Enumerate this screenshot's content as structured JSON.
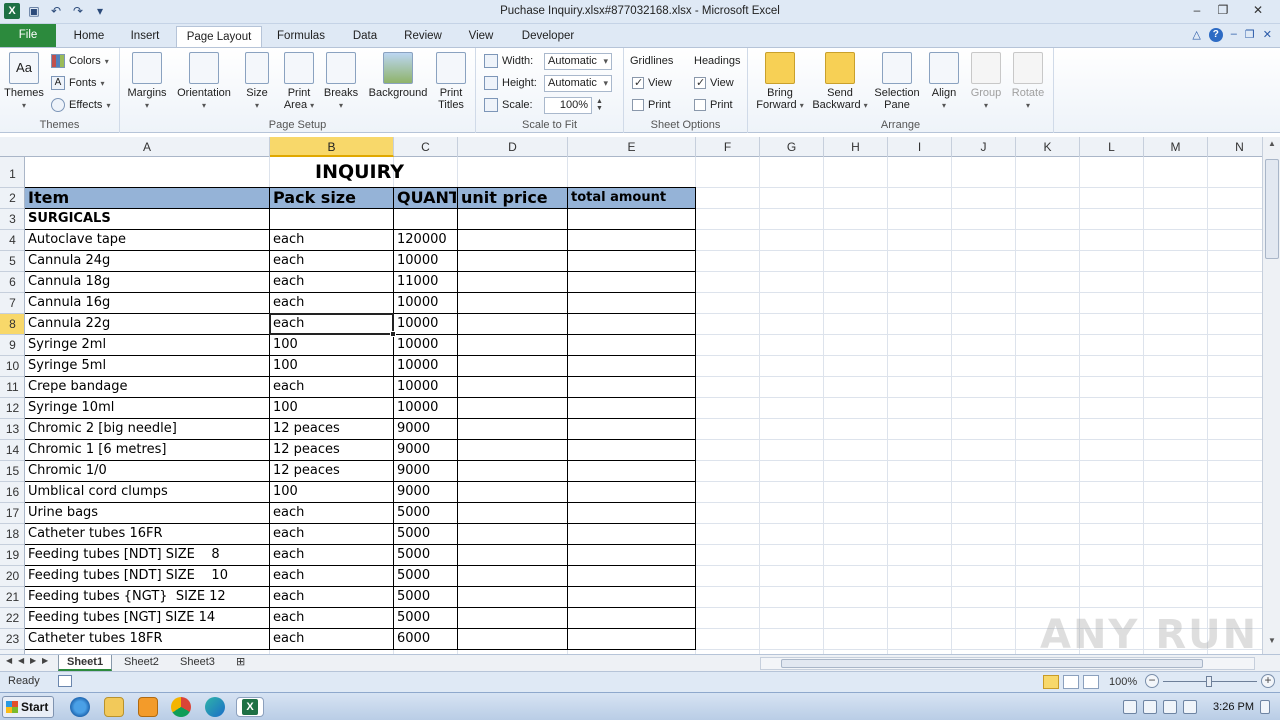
{
  "titlebar": {
    "title": "Puchase Inquiry.xlsx#877032168.xlsx  -  Microsoft Excel"
  },
  "tabs": {
    "file": "File",
    "home": "Home",
    "insert": "Insert",
    "page_layout": "Page Layout",
    "formulas": "Formulas",
    "data": "Data",
    "review": "Review",
    "view": "View",
    "developer": "Developer"
  },
  "ribbon": {
    "themes": {
      "themes": "Themes",
      "colors": "Colors",
      "fonts": "Fonts",
      "effects": "Effects",
      "group": "Themes"
    },
    "page_setup": {
      "margins": "Margins",
      "orientation": "Orientation",
      "size": "Size",
      "print_area_1": "Print",
      "print_area_2": "Area",
      "breaks": "Breaks",
      "background": "Background",
      "print_titles_1": "Print",
      "print_titles_2": "Titles",
      "group": "Page Setup"
    },
    "scale": {
      "width_label": "Width:",
      "width_value": "Automatic",
      "height_label": "Height:",
      "height_value": "Automatic",
      "scale_label": "Scale:",
      "scale_value": "100%",
      "group": "Scale to Fit"
    },
    "sheet_options": {
      "gridlines": "Gridlines",
      "headings": "Headings",
      "view1": "View",
      "print1": "Print",
      "view2": "View",
      "print2": "Print",
      "group": "Sheet Options"
    },
    "arrange": {
      "bring_forward_1": "Bring",
      "bring_forward_2": "Forward",
      "send_backward_1": "Send",
      "send_backward_2": "Backward",
      "selection_pane_1": "Selection",
      "selection_pane_2": "Pane",
      "align": "Align",
      "group_btn": "Group",
      "rotate": "Rotate",
      "group": "Arrange"
    }
  },
  "columns": [
    "A",
    "B",
    "C",
    "D",
    "E",
    "F",
    "G",
    "H",
    "I",
    "J",
    "K",
    "L",
    "M",
    "N"
  ],
  "rows": [
    "1",
    "2",
    "3",
    "4",
    "5",
    "6",
    "7",
    "8",
    "9",
    "10",
    "11",
    "12",
    "13",
    "14",
    "15",
    "16",
    "17",
    "18",
    "19",
    "20",
    "21",
    "22",
    "23"
  ],
  "sheet": {
    "title": "INQUIRY",
    "headers": {
      "item": "Item",
      "pack": "Pack size",
      "qty": "QUANT",
      "unit_price": "unit price",
      "total": "total amount"
    },
    "section": "SURGICALS",
    "items": [
      {
        "item": "Autoclave tape",
        "pack": "each",
        "qty": "120000"
      },
      {
        "item": "Cannula 24g",
        "pack": "each",
        "qty": "10000"
      },
      {
        "item": "Cannula 18g",
        "pack": "each",
        "qty": "11000"
      },
      {
        "item": "Cannula 16g",
        "pack": "each",
        "qty": "10000"
      },
      {
        "item": "Cannula 22g",
        "pack": "each",
        "qty": "10000"
      },
      {
        "item": "Syringe 2ml",
        "pack": "100",
        "qty": "10000"
      },
      {
        "item": "Syringe 5ml",
        "pack": "100",
        "qty": "10000"
      },
      {
        "item": "Crepe bandage",
        "pack": "each",
        "qty": "10000"
      },
      {
        "item": "Syringe 10ml",
        "pack": "100",
        "qty": "10000"
      },
      {
        "item": "Chromic 2 [big needle]",
        "pack": "12 peaces",
        "qty": "9000"
      },
      {
        "item": "Chromic 1 [6 metres]",
        "pack": "12 peaces",
        "qty": "9000"
      },
      {
        "item": "Chromic 1/0",
        "pack": "12 peaces",
        "qty": "9000"
      },
      {
        "item": "Umblical cord clumps",
        "pack": "100",
        "qty": "9000"
      },
      {
        "item": "Urine bags",
        "pack": "each",
        "qty": "5000"
      },
      {
        "item": "Catheter tubes 16FR",
        "pack": "each",
        "qty": "5000"
      },
      {
        "item": "Feeding tubes [NDT] SIZE    8",
        "pack": "each",
        "qty": "5000"
      },
      {
        "item": "Feeding tubes [NDT] SIZE    10",
        "pack": "each",
        "qty": "5000"
      },
      {
        "item": "Feeding tubes {NGT}  SIZE 12",
        "pack": "each",
        "qty": "5000"
      },
      {
        "item": "Feeding tubes [NGT] SIZE 14",
        "pack": "each",
        "qty": "5000"
      },
      {
        "item": "Catheter tubes 18FR",
        "pack": "each",
        "qty": "6000"
      }
    ]
  },
  "sheet_tabs": [
    "Sheet1",
    "Sheet2",
    "Sheet3"
  ],
  "status": {
    "ready": "Ready",
    "zoom": "100%"
  },
  "taskbar": {
    "start": "Start",
    "clock": "3:26 PM"
  },
  "watermark": "ANY RUN",
  "colors": {
    "header_fill": "#95b3d7",
    "selected_header": "#f8d86a",
    "file_tab": "#2c8a3d"
  }
}
